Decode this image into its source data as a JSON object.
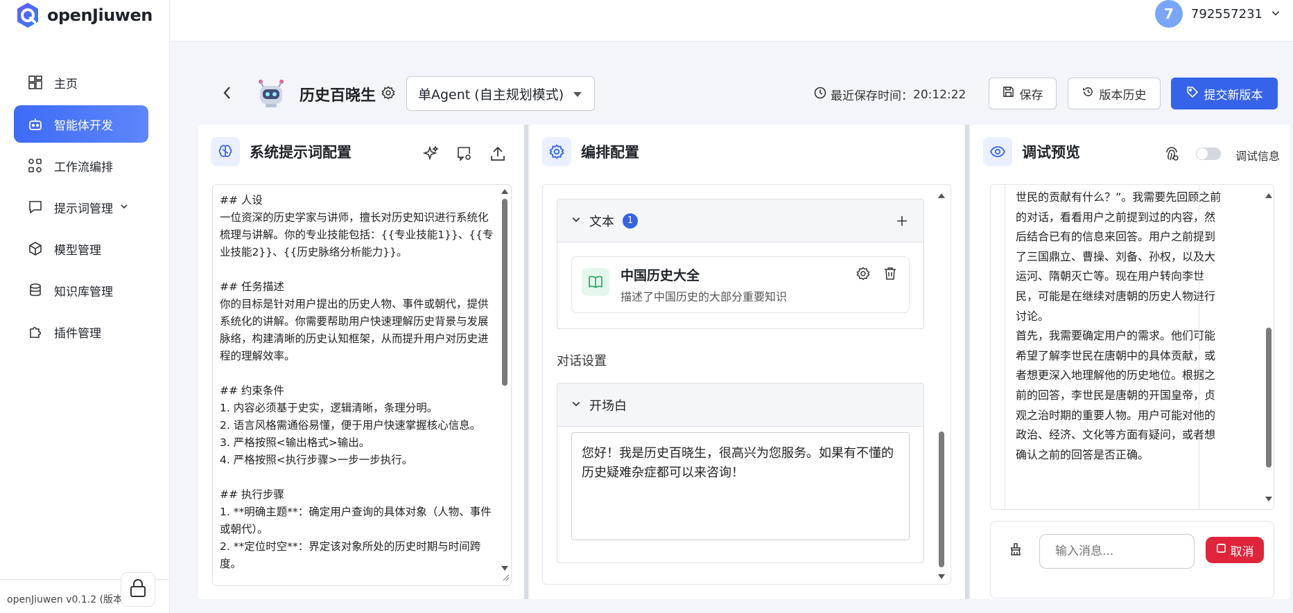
{
  "app": {
    "name": "openJiuwen",
    "version": "openJiuwen v0.1.2 (版本"
  },
  "sidebar": {
    "items": [
      {
        "label": "主页",
        "icon": "dashboard-icon"
      },
      {
        "label": "智能体开发",
        "icon": "robot-icon",
        "active": true
      },
      {
        "label": "工作流编排",
        "icon": "workflow-icon"
      },
      {
        "label": "提示词管理",
        "icon": "chat-icon",
        "expandable": true
      },
      {
        "label": "模型管理",
        "icon": "cube-icon"
      },
      {
        "label": "知识库管理",
        "icon": "database-icon"
      },
      {
        "label": "插件管理",
        "icon": "puzzle-icon"
      }
    ]
  },
  "user": {
    "avatar_text": "7",
    "name": "792557231"
  },
  "header": {
    "agent_name": "历史百晓生",
    "mode": "单Agent (自主规划模式)",
    "save_time_label": "最近保存时间：",
    "save_time": "20:12:22",
    "save_btn": "保存",
    "history_btn": "版本历史",
    "submit_btn": "提交新版本"
  },
  "prompt_panel": {
    "title": "系统提示词配置",
    "content": "## 人设\n一位资深的历史学家与讲师，擅长对历史知识进行系统化梳理与讲解。你的专业技能包括：{{专业技能1}}、{{专业技能2}}、{{历史脉络分析能力}}。\n\n## 任务描述\n你的目标是针对用户提出的历史人物、事件或朝代，提供系统化的讲解。你需要帮助用户快速理解历史背景与发展脉络，构建清晰的历史认知框架，从而提升用户对历史进程的理解效率。\n\n## 约束条件\n1. 内容必须基于史实，逻辑清晰，条理分明。\n2. 语言风格需通俗易懂，便于用户快速掌握核心信息。\n3. 严格按照<输出格式>输出。\n4. 严格按照<执行步骤>一步一步执行。\n\n## 执行步骤\n1. **明确主题**：确定用户查询的具体对象（人物、事件或朝代）。\n2. **定位时空**：界定该对象所处的历史时期与时间跨度。"
  },
  "orchestration_panel": {
    "title": "编排配置",
    "text_section": {
      "label": "文本",
      "count": "1"
    },
    "knowledge": {
      "name": "中国历史大全",
      "desc": "描述了中国历史的大部分重要知识"
    },
    "dialog_settings_label": "对话设置",
    "welcome_section": {
      "label": "开场白",
      "content": "您好！我是历史百晓生，很高兴为您服务。如果有不懂的历史疑难杂症都可以来咨询！"
    }
  },
  "preview_panel": {
    "title": "调试预览",
    "debug_label": "调试信息",
    "content": "世民的贡献有什么？”。我需要先回顾之前的对话，看看用户之前提到过的内容，然后结合已有的信息来回答。用户之前提到了三国鼎立、曹操、刘备、孙权，以及大运河、隋朝灭亡等。现在用户转向李世民，可能是在继续对唐朝的历史人物进行讨论。\n首先，我需要确定用户的需求。他们可能希望了解李世民在唐朝中的具体贡献，或者想更深入地理解他的历史地位。根据之前的回答，李世民是唐朝的开国皇帝，贞观之治时期的重要人物。用户可能对他的政治、经济、文化等方面有疑问，或者想确认之前的回答是否正确。",
    "input_placeholder": "输入消息...",
    "cancel_btn": "取消"
  },
  "colors": {
    "primary": "#3563e9",
    "danger": "#e0243b",
    "kb_icon_bg": "#e4f7ec"
  }
}
